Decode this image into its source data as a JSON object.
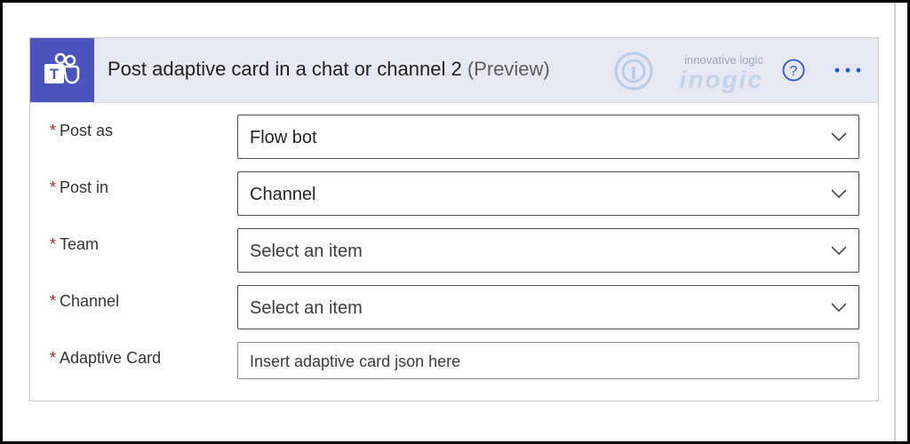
{
  "header": {
    "title": "Post adaptive card in a chat or channel 2",
    "preview": "(Preview)",
    "watermark_tagline": "innovative logic",
    "watermark_brand": "inogic",
    "icon": "teams-icon"
  },
  "fields": [
    {
      "required_mark": "*",
      "label": "Post as",
      "value": "Flow bot"
    },
    {
      "required_mark": "*",
      "label": "Post in",
      "value": "Channel"
    },
    {
      "required_mark": "*",
      "label": "Team",
      "value": "Select an item"
    },
    {
      "required_mark": "*",
      "label": "Channel",
      "value": "Select an item"
    },
    {
      "required_mark": "*",
      "label": "Adaptive Card",
      "placeholder": "Insert adaptive card json here"
    }
  ],
  "colors": {
    "teams_tile": "#4b53bc",
    "header_bg": "#e8e8f5",
    "required": "#a4262c",
    "help_icon": "#2b59c3"
  }
}
